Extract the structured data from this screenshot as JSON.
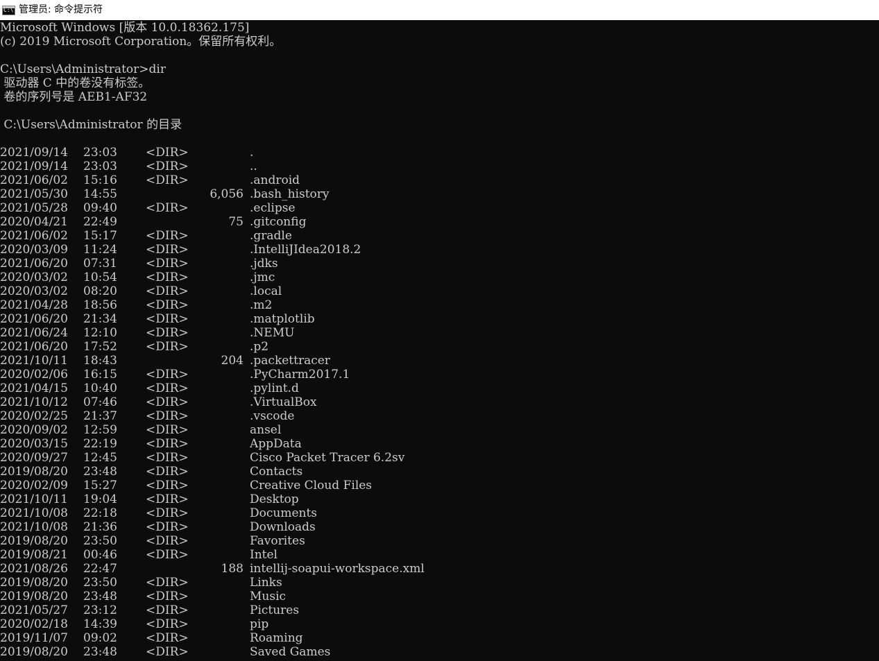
{
  "window": {
    "title": "管理员: 命令提示符",
    "icon": "console-icon",
    "icon_text": "C:\\"
  },
  "colors": {
    "background": "#0c0c0c",
    "text": "#cccccc",
    "titlebar": "#ffffff"
  },
  "header_lines": [
    "Microsoft Windows [版本 10.0.18362.175]",
    "(c) 2019 Microsoft Corporation。保留所有权利。",
    "",
    "C:\\Users\\Administrator>dir",
    " 驱动器 C 中的卷没有标签。",
    " 卷的序列号是 AEB1-AF32",
    "",
    " C:\\Users\\Administrator 的目录",
    ""
  ],
  "listing": [
    {
      "date": "2021/09/14",
      "time": "23:03",
      "dir": "<DIR>",
      "size": "",
      "name": "."
    },
    {
      "date": "2021/09/14",
      "time": "23:03",
      "dir": "<DIR>",
      "size": "",
      "name": ".."
    },
    {
      "date": "2021/06/02",
      "time": "15:16",
      "dir": "<DIR>",
      "size": "",
      "name": ".android"
    },
    {
      "date": "2021/05/30",
      "time": "14:55",
      "dir": "",
      "size": "6,056",
      "name": ".bash_history"
    },
    {
      "date": "2021/05/28",
      "time": "09:40",
      "dir": "<DIR>",
      "size": "",
      "name": ".eclipse"
    },
    {
      "date": "2020/04/21",
      "time": "22:49",
      "dir": "",
      "size": "75",
      "name": ".gitconfig"
    },
    {
      "date": "2021/06/02",
      "time": "15:17",
      "dir": "<DIR>",
      "size": "",
      "name": ".gradle"
    },
    {
      "date": "2020/03/09",
      "time": "11:24",
      "dir": "<DIR>",
      "size": "",
      "name": ".IntelliJIdea2018.2"
    },
    {
      "date": "2021/06/20",
      "time": "07:31",
      "dir": "<DIR>",
      "size": "",
      "name": ".jdks"
    },
    {
      "date": "2020/03/02",
      "time": "10:54",
      "dir": "<DIR>",
      "size": "",
      "name": ".jmc"
    },
    {
      "date": "2020/03/02",
      "time": "08:20",
      "dir": "<DIR>",
      "size": "",
      "name": ".local"
    },
    {
      "date": "2021/04/28",
      "time": "18:56",
      "dir": "<DIR>",
      "size": "",
      "name": ".m2"
    },
    {
      "date": "2021/06/20",
      "time": "21:34",
      "dir": "<DIR>",
      "size": "",
      "name": ".matplotlib"
    },
    {
      "date": "2021/06/24",
      "time": "12:10",
      "dir": "<DIR>",
      "size": "",
      "name": ".NEMU"
    },
    {
      "date": "2021/06/20",
      "time": "17:52",
      "dir": "<DIR>",
      "size": "",
      "name": ".p2"
    },
    {
      "date": "2021/10/11",
      "time": "18:43",
      "dir": "",
      "size": "204",
      "name": ".packettracer"
    },
    {
      "date": "2020/02/06",
      "time": "16:15",
      "dir": "<DIR>",
      "size": "",
      "name": ".PyCharm2017.1"
    },
    {
      "date": "2021/04/15",
      "time": "10:40",
      "dir": "<DIR>",
      "size": "",
      "name": ".pylint.d"
    },
    {
      "date": "2021/10/12",
      "time": "07:46",
      "dir": "<DIR>",
      "size": "",
      "name": ".VirtualBox"
    },
    {
      "date": "2020/02/25",
      "time": "21:37",
      "dir": "<DIR>",
      "size": "",
      "name": ".vscode"
    },
    {
      "date": "2020/09/02",
      "time": "12:59",
      "dir": "<DIR>",
      "size": "",
      "name": "ansel"
    },
    {
      "date": "2020/03/15",
      "time": "22:19",
      "dir": "<DIR>",
      "size": "",
      "name": "AppData"
    },
    {
      "date": "2020/09/27",
      "time": "12:45",
      "dir": "<DIR>",
      "size": "",
      "name": "Cisco Packet Tracer 6.2sv"
    },
    {
      "date": "2019/08/20",
      "time": "23:48",
      "dir": "<DIR>",
      "size": "",
      "name": "Contacts"
    },
    {
      "date": "2020/02/09",
      "time": "15:27",
      "dir": "<DIR>",
      "size": "",
      "name": "Creative Cloud Files"
    },
    {
      "date": "2021/10/11",
      "time": "19:04",
      "dir": "<DIR>",
      "size": "",
      "name": "Desktop"
    },
    {
      "date": "2021/10/08",
      "time": "22:18",
      "dir": "<DIR>",
      "size": "",
      "name": "Documents"
    },
    {
      "date": "2021/10/08",
      "time": "21:36",
      "dir": "<DIR>",
      "size": "",
      "name": "Downloads"
    },
    {
      "date": "2019/08/20",
      "time": "23:50",
      "dir": "<DIR>",
      "size": "",
      "name": "Favorites"
    },
    {
      "date": "2019/08/21",
      "time": "00:46",
      "dir": "<DIR>",
      "size": "",
      "name": "Intel"
    },
    {
      "date": "2021/08/26",
      "time": "22:47",
      "dir": "",
      "size": "188",
      "name": "intellij-soapui-workspace.xml"
    },
    {
      "date": "2019/08/20",
      "time": "23:50",
      "dir": "<DIR>",
      "size": "",
      "name": "Links"
    },
    {
      "date": "2019/08/20",
      "time": "23:48",
      "dir": "<DIR>",
      "size": "",
      "name": "Music"
    },
    {
      "date": "2021/05/27",
      "time": "23:12",
      "dir": "<DIR>",
      "size": "",
      "name": "Pictures"
    },
    {
      "date": "2020/02/18",
      "time": "14:39",
      "dir": "<DIR>",
      "size": "",
      "name": "pip"
    },
    {
      "date": "2019/11/07",
      "time": "09:02",
      "dir": "<DIR>",
      "size": "",
      "name": "Roaming"
    },
    {
      "date": "2019/08/20",
      "time": "23:48",
      "dir": "<DIR>",
      "size": "",
      "name": "Saved Games"
    }
  ]
}
